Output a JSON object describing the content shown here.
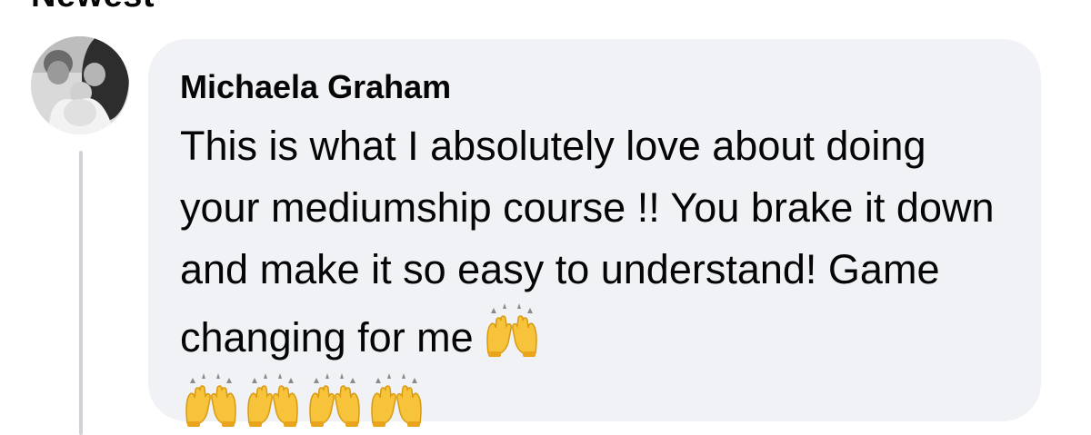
{
  "header": {
    "sort_label": "Newest"
  },
  "comment": {
    "author": "Michaela Graham",
    "text": "This is what I absolutely love about doing your mediumship course !! You brake it down and make it so easy to understand! Game changing for me",
    "inline_emoji": "raising-hands",
    "trailing_emojis": [
      "raising-hands",
      "raising-hands",
      "raising-hands",
      "raising-hands"
    ]
  },
  "colors": {
    "bubble_background": "#f0f2f5",
    "text": "#050505",
    "thread_line": "#cfd2d6",
    "emoji_yellow": "#f7c33a"
  },
  "icons": {
    "avatar": "profile-photo-family",
    "emoji": "raising-hands-emoji"
  }
}
